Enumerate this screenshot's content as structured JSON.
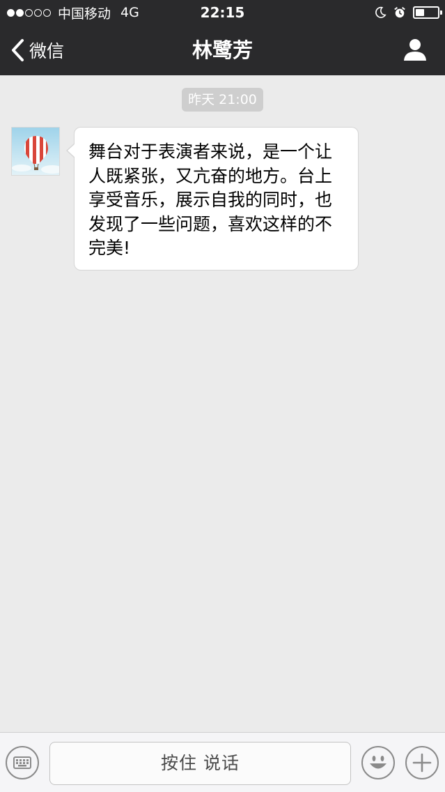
{
  "status_bar": {
    "signal_dots_filled": 2,
    "signal_dots_total": 5,
    "carrier": "中国移动",
    "network": "4G",
    "time": "22:15",
    "icons": [
      "moon-icon",
      "alarm-clock-icon",
      "battery-icon"
    ],
    "battery_level": 0.4
  },
  "nav": {
    "back_label": "微信",
    "title": "林鹭芳",
    "profile_icon": "person-icon"
  },
  "chat": {
    "timestamp": "昨天 21:00",
    "messages": [
      {
        "sender": "incoming",
        "avatar_icon": "hot-air-balloon-avatar",
        "text": "舞台对于表演者来说，是一个让人既紧张，又亢奋的地方。台上享受音乐，展示自我的同时，也发现了一些问题，喜欢这样的不完美!"
      }
    ]
  },
  "input_bar": {
    "keyboard_icon": "keyboard-icon",
    "hold_to_talk_label": "按住 说话",
    "emoji_icon": "smiley-icon",
    "more_icon": "plus-icon"
  },
  "colors": {
    "topbar_bg": "#2a2a2c",
    "chat_bg": "#ebebeb",
    "timestamp_bg": "#cecece",
    "bubble_bg": "#ffffff"
  }
}
